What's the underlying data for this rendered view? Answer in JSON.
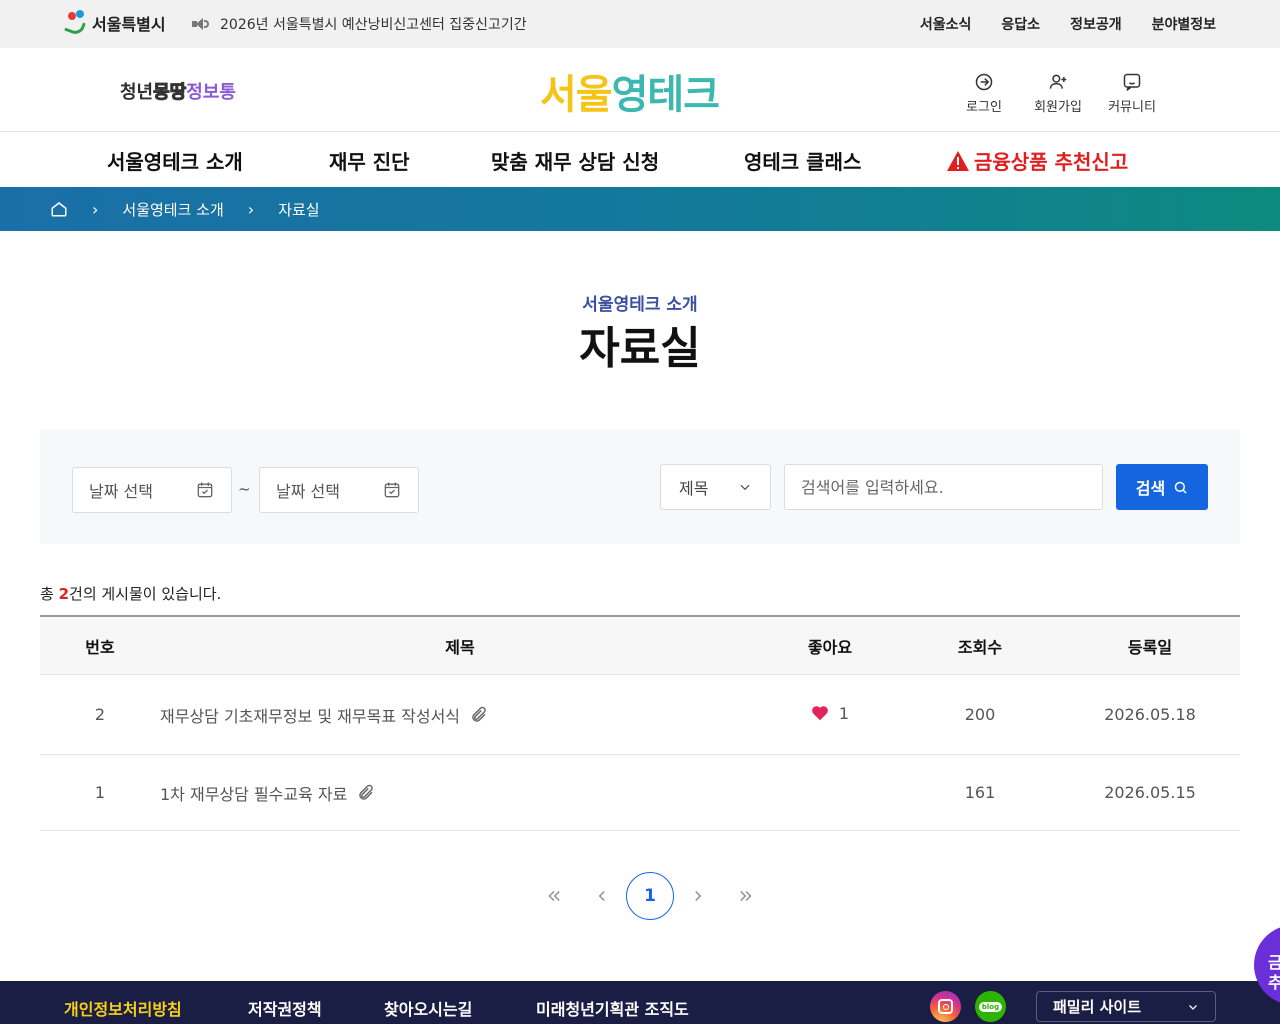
{
  "topbar": {
    "seoul_logo": "서울특별시",
    "notice": "2026년 서울특별시 예산낭비신고센터 집중신고기간",
    "links": [
      "서울소식",
      "응답소",
      "정보공개",
      "분야별정보"
    ]
  },
  "header": {
    "youth_logo": [
      "청년",
      "몽땅",
      "정보통"
    ],
    "brand_logo": [
      "서울",
      "영테크"
    ],
    "login_label": "로그인",
    "signup_label": "회원가입",
    "community_label": "커뮤니티"
  },
  "gnb": {
    "items": [
      "서울영테크 소개",
      "재무 진단",
      "맞춤 재무 상담 신청",
      "영테크 클래스",
      "금융상품 추천신고"
    ]
  },
  "breadcrumb": {
    "items": [
      "서울영테크 소개",
      "자료실"
    ]
  },
  "page": {
    "subtitle": "서울영테크 소개",
    "title": "자료실"
  },
  "search": {
    "date_start_placeholder": "날짜 선택",
    "date_end_placeholder": "날짜 선택",
    "tilde": "~",
    "select_value": "제목",
    "keyword_placeholder": "검색어를 입력하세요.",
    "button_label": "검색"
  },
  "total": {
    "prefix": "총 ",
    "count": "2",
    "suffix": "건의 게시물이 있습니다."
  },
  "table": {
    "headers": [
      "번호",
      "제목",
      "좋아요",
      "조회수",
      "등록일"
    ],
    "rows": [
      {
        "no": "2",
        "title": "재무상담 기초재무정보 및 재무목표 작성서식",
        "likes": "1",
        "views": "200",
        "date": "2026.05.18"
      },
      {
        "no": "1",
        "title": "1차 재무상담 필수교육 자료",
        "likes": "",
        "views": "161",
        "date": "2026.05.15"
      }
    ]
  },
  "pagination": {
    "current": "1"
  },
  "footer": {
    "links": [
      "개인정보처리방침",
      "저작권정책",
      "찾아오시는길",
      "미래청년기획관 조직도"
    ],
    "blog_label": "blog",
    "family_site": "패밀리 사이트"
  },
  "floating": {
    "label_line1": "금",
    "label_line2": "추"
  },
  "colors": {
    "primary": "#1565e0",
    "accent_red": "#e02020",
    "footer_bg": "#1a1d44",
    "breadcrumb_start": "#1a6fa8",
    "breadcrumb_end": "#0d8a80"
  }
}
